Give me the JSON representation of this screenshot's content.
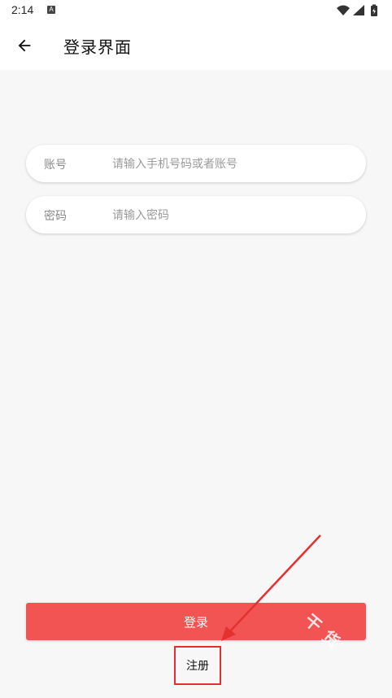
{
  "status_bar": {
    "time": "2:14",
    "notification_icon": "a-icon",
    "badge_letter": "A"
  },
  "app_bar": {
    "title": "登录界面",
    "back_icon": "arrow-left-icon"
  },
  "form": {
    "account": {
      "label": "账号",
      "placeholder": "请输入手机号码或者账号",
      "value": ""
    },
    "password": {
      "label": "密码",
      "placeholder": "请输入密码",
      "value": ""
    }
  },
  "actions": {
    "login_label": "登录",
    "register_label": "注册"
  },
  "annotation": {
    "highlight_color": "#e53030",
    "arrow_color": "#e53030"
  },
  "watermark": {
    "chars": [
      "干",
      "货",
      "",
      ""
    ]
  },
  "colors": {
    "primary": "#f25454",
    "background": "#f7f7f7",
    "surface": "#ffffff"
  }
}
